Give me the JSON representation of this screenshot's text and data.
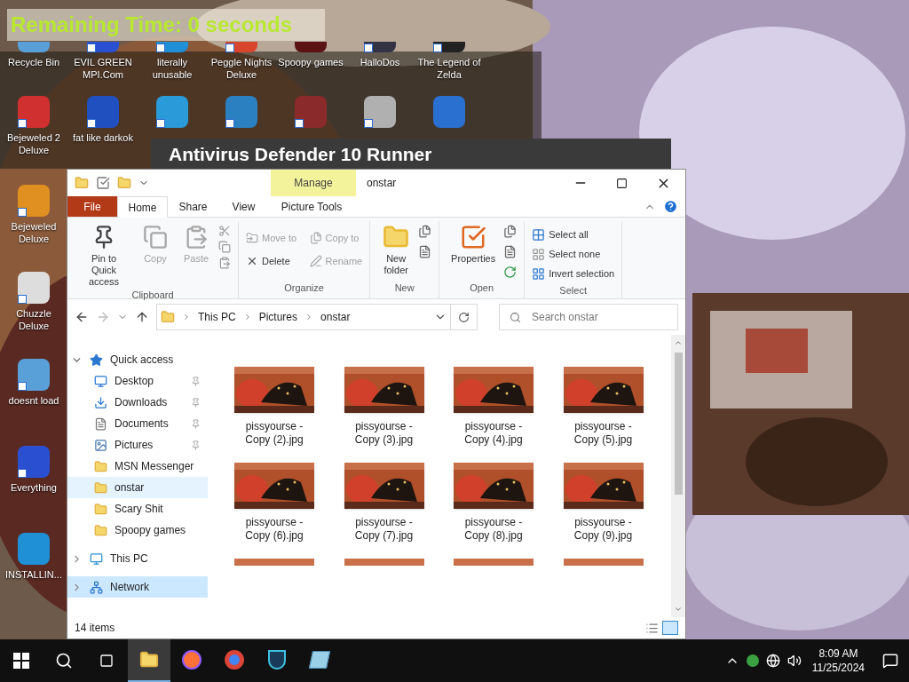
{
  "overlay": {
    "text": "Remaining Time: 0 seconds"
  },
  "desktop_rows": [
    [
      {
        "label": "Recycle Bin",
        "shortcut": false
      },
      {
        "label": "EVIL GREEN MPI.Com",
        "shortcut": true
      },
      {
        "label": "literally unusable",
        "shortcut": true
      },
      {
        "label": "Peggle Nights Deluxe",
        "shortcut": true
      },
      {
        "label": "Spoopy games",
        "shortcut": false
      },
      {
        "label": "HalloDos",
        "shortcut": true
      },
      {
        "label": "The Legend of Zelda",
        "shortcut": true
      }
    ],
    [
      {
        "label": "Bejeweled 2 Deluxe",
        "shortcut": true
      },
      {
        "label": "fat like darkok",
        "shortcut": true
      },
      {
        "shortcut": true
      },
      {
        "shortcut": true
      },
      {
        "shortcut": true
      },
      {
        "shortcut": true
      },
      {
        "shortcut": false
      }
    ]
  ],
  "desktop_column": [
    {
      "label": "Bejeweled Deluxe",
      "shortcut": true
    },
    {
      "label": "Chuzzle Deluxe",
      "shortcut": true
    },
    {
      "label": "doesnt load",
      "shortcut": true
    },
    {
      "label": "Everything",
      "shortcut": true
    },
    {
      "label": "INSTALLIN...",
      "shortcut": false
    }
  ],
  "background_window": {
    "title": "Antivirus Defender 10 Runner"
  },
  "explorer": {
    "contextual_tab": "Manage",
    "title": "onstar",
    "tabs": [
      {
        "label": "File",
        "kind": "file",
        "selected": false
      },
      {
        "label": "Home",
        "kind": "tab",
        "selected": true
      },
      {
        "label": "Share",
        "kind": "tab",
        "selected": false
      },
      {
        "label": "View",
        "kind": "tab",
        "selected": false
      },
      {
        "label": "Picture Tools",
        "kind": "contextual",
        "selected": false
      }
    ],
    "groups": [
      {
        "label": "Clipboard",
        "items": [
          {
            "label": "Pin to Quick access",
            "kind": "pin",
            "disabled": false
          },
          {
            "label": "Copy",
            "kind": "copy",
            "disabled": true
          },
          {
            "label": "Paste",
            "kind": "paste",
            "disabled": true
          }
        ]
      },
      {
        "label": "Organize",
        "items": [
          {
            "label": "Move to",
            "kind": "move",
            "disabled": true
          },
          {
            "label": "Copy to",
            "kind": "copyto",
            "disabled": true
          },
          {
            "label": "Delete",
            "kind": "delete",
            "disabled": false
          },
          {
            "label": "Rename",
            "kind": "rename",
            "disabled": true
          }
        ]
      },
      {
        "label": "New",
        "items": [
          {
            "label": "New folder",
            "kind": "newfolder",
            "disabled": false
          }
        ]
      },
      {
        "label": "Open",
        "items": [
          {
            "label": "Properties",
            "kind": "properties",
            "disabled": false
          }
        ]
      },
      {
        "label": "Select",
        "items": [
          {
            "label": "Select all",
            "kind": "selectall",
            "disabled": false
          },
          {
            "label": "Select none",
            "kind": "selectnone",
            "disabled": false
          },
          {
            "label": "Invert selection",
            "kind": "invert",
            "disabled": false
          }
        ]
      }
    ],
    "breadcrumb": [
      "This PC",
      "Pictures",
      "onstar"
    ],
    "search": {
      "placeholder": "Search onstar"
    },
    "nav": [
      {
        "label": "Quick access",
        "kind": "star",
        "expanded": true,
        "selected": false,
        "children": [
          {
            "label": "Desktop",
            "kind": "desktop",
            "pinned": true,
            "selected": false
          },
          {
            "label": "Downloads",
            "kind": "downloads",
            "pinned": true,
            "selected": false
          },
          {
            "label": "Documents",
            "kind": "documents",
            "pinned": true,
            "selected": false
          },
          {
            "label": "Pictures",
            "kind": "pictures",
            "pinned": true,
            "selected": false
          },
          {
            "label": "MSN Messenger",
            "kind": "folder",
            "pinned": false,
            "selected": false
          },
          {
            "label": "onstar",
            "kind": "folder",
            "pinned": false,
            "selected": true
          },
          {
            "label": "Scary Shit",
            "kind": "folder",
            "pinned": false,
            "selected": false
          },
          {
            "label": "Spoopy games",
            "kind": "folder",
            "pinned": false,
            "selected": false
          }
        ]
      },
      {
        "label": "This PC",
        "kind": "pc",
        "expanded": false,
        "selected": false
      },
      {
        "label": "Network",
        "kind": "network",
        "expanded": false,
        "selected": true
      }
    ],
    "files": [
      {
        "name": "pissyourse - Copy (2).jpg"
      },
      {
        "name": "pissyourse - Copy (3).jpg"
      },
      {
        "name": "pissyourse - Copy (4).jpg"
      },
      {
        "name": "pissyourse - Copy (5).jpg"
      },
      {
        "name": "pissyourse - Copy (6).jpg"
      },
      {
        "name": "pissyourse - Copy (7).jpg"
      },
      {
        "name": "pissyourse - Copy (8).jpg"
      },
      {
        "name": "pissyourse - Copy (9).jpg"
      },
      {
        "kind": "picture"
      },
      {
        "kind": "picture"
      },
      {
        "kind": "picture"
      },
      {
        "kind": "picture"
      }
    ],
    "status": "14 items"
  },
  "taskbar": {
    "apps": [
      {
        "kind": "explorer",
        "active": true
      },
      {
        "kind": "firefox",
        "active": false
      },
      {
        "kind": "chrome",
        "active": false
      },
      {
        "kind": "shield",
        "active": false
      },
      {
        "kind": "notepad",
        "active": false
      }
    ],
    "time": "8:09 AM",
    "date": "11/25/2024"
  }
}
